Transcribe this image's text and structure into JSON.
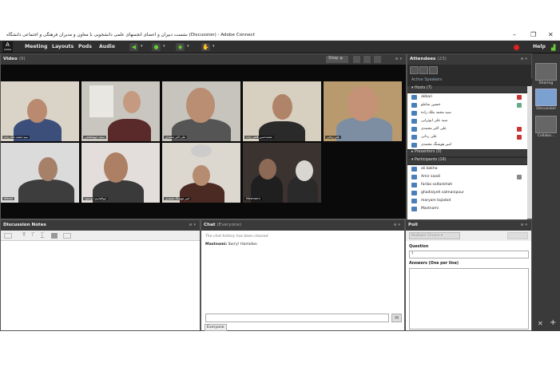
{
  "window": {
    "title": "نشست دبیران و اعضای انجمنهای علمی دانشجویی با معاون و مدیران فرهنگی و اجتماعی دانشگاه (Discussion) - Adobe Connect",
    "minimize": "–",
    "maximize": "❐",
    "close": "✕"
  },
  "menu": {
    "logo": "A",
    "logo_sub": "Adobe",
    "items": [
      "Meeting",
      "Layouts",
      "Pods",
      "Audio"
    ],
    "help": "Help"
  },
  "video": {
    "title": "Video",
    "count": "(9)",
    "stop": "Stop",
    "tiles": [
      {
        "name": "سید محمد ملک زاده",
        "bg": "#d9d3c8"
      },
      {
        "name": "سعید جیهانشاهی",
        "bg": "#c9c6bf"
      },
      {
        "name": "علی اکبر محمدی",
        "bg": "#c7c4bd"
      },
      {
        "name": "محمدحسن قلمی زاده",
        "bg": "#d7cfbf"
      },
      {
        "name": "علی ردانی",
        "bg": "#b99a6e"
      },
      {
        "name": "akbari",
        "bg": "#dbdbdb"
      },
      {
        "name": "ابوالقاسم ابوسعید",
        "bg": "#e3dedb"
      },
      {
        "name": "امیر هوشنگ محمدی",
        "bg": "#dcd7cf"
      },
      {
        "name": "Mastnami",
        "bg": "#3b3330"
      }
    ]
  },
  "attendees": {
    "title": "Attendees",
    "count": "(23)",
    "active_speakers": "Active Speakers",
    "hosts_label": "Hosts (7)",
    "hosts": [
      "akbari",
      "حسین شاملو",
      "سید محمد ملک زاده",
      "سید علی ابوترابی",
      "علی اکبر محمدی",
      "علی ردانی",
      "امیر هوشنگ محمدی"
    ],
    "presenters_label": "Presenters (0)",
    "participants_label": "Participants (16)",
    "participants": [
      "ali bakha",
      "Amir saadi",
      "fariba soltankhah",
      "ghadisiyeh salmanipour",
      "maryam tajadod",
      "Mastnami"
    ]
  },
  "notes": {
    "title": "Discussion Notes"
  },
  "chat": {
    "title": "Chat",
    "scope": "(Everyone)",
    "cleared": "The chat history has been cleared",
    "msg_name": "Mastnami:",
    "msg_text": "Sorry! Hamidan",
    "tab": "Everyone"
  },
  "poll": {
    "title": "Poll",
    "type": "Multiple Choice",
    "question_label": "Question",
    "question_value": "?",
    "answers_label": "Answers (One per line)"
  },
  "rail": {
    "sharing": "Sharing",
    "discussion": "Discussion",
    "collab": "Collabo..."
  }
}
